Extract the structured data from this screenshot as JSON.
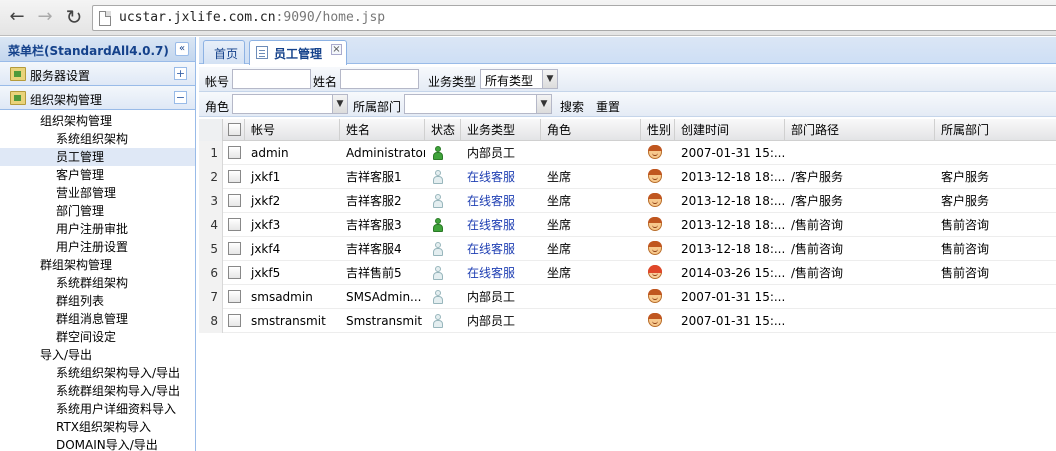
{
  "browser": {
    "url_host": "ucstar.jxlife.com.cn",
    "url_rest": ":9090/home.jsp"
  },
  "menu": {
    "title": "菜单栏(StandardAll4.0.7)",
    "sections": [
      {
        "label": "服务器设置",
        "toggle": "+"
      },
      {
        "label": "组织架构管理",
        "toggle": "−"
      }
    ],
    "tree": [
      {
        "label": "组织架构管理",
        "level": 1
      },
      {
        "label": "系统组织架构",
        "level": 2
      },
      {
        "label": "员工管理",
        "level": 2,
        "selected": true
      },
      {
        "label": "客户管理",
        "level": 2
      },
      {
        "label": "营业部管理",
        "level": 2
      },
      {
        "label": "部门管理",
        "level": 2
      },
      {
        "label": "用户注册审批",
        "level": 2
      },
      {
        "label": "用户注册设置",
        "level": 2
      },
      {
        "label": "群组架构管理",
        "level": 1
      },
      {
        "label": "系统群组架构",
        "level": 2
      },
      {
        "label": "群组列表",
        "level": 2
      },
      {
        "label": "群组消息管理",
        "level": 2
      },
      {
        "label": "群空间设定",
        "level": 2
      },
      {
        "label": "导入/导出",
        "level": 1
      },
      {
        "label": "系统组织架构导入/导出",
        "level": 2
      },
      {
        "label": "系统群组架构导入/导出",
        "level": 2
      },
      {
        "label": "系统用户详细资料导入",
        "level": 2
      },
      {
        "label": "RTX组织架构导入",
        "level": 2
      },
      {
        "label": "DOMAIN导入/导出",
        "level": 2
      }
    ]
  },
  "tabs": {
    "home": "首页",
    "active": "员工管理"
  },
  "filters": {
    "account_label": "帐号",
    "name_label": "姓名",
    "biz_type_label": "业务类型",
    "biz_type_value": "所有类型",
    "role_label": "角色",
    "dept_label": "所属部门",
    "search": "搜索",
    "reset": "重置"
  },
  "grid": {
    "columns": [
      "帐号",
      "姓名",
      "状态",
      "业务类型",
      "角色",
      "性别",
      "创建时间",
      "部门路径",
      "所属部门"
    ],
    "rows": [
      {
        "num": "1",
        "account": "admin",
        "name": "Administrator",
        "status": "online",
        "biz": "内部员工",
        "biz_link": false,
        "role": "",
        "gender": "male",
        "created": "2007-01-31 15:...",
        "path": "",
        "dept": ""
      },
      {
        "num": "2",
        "account": "jxkf1",
        "name": "吉祥客服1",
        "status": "offline",
        "biz": "在线客服",
        "biz_link": true,
        "role": "坐席",
        "gender": "male",
        "created": "2013-12-18 18:...",
        "path": "/客户服务",
        "dept": "客户服务"
      },
      {
        "num": "3",
        "account": "jxkf2",
        "name": "吉祥客服2",
        "status": "offline",
        "biz": "在线客服",
        "biz_link": true,
        "role": "坐席",
        "gender": "male",
        "created": "2013-12-18 18:...",
        "path": "/客户服务",
        "dept": "客户服务"
      },
      {
        "num": "4",
        "account": "jxkf3",
        "name": "吉祥客服3",
        "status": "online",
        "biz": "在线客服",
        "biz_link": true,
        "role": "坐席",
        "gender": "male",
        "created": "2013-12-18 18:...",
        "path": "/售前咨询",
        "dept": "售前咨询"
      },
      {
        "num": "5",
        "account": "jxkf4",
        "name": "吉祥客服4",
        "status": "offline",
        "biz": "在线客服",
        "biz_link": true,
        "role": "坐席",
        "gender": "male",
        "created": "2013-12-18 18:...",
        "path": "/售前咨询",
        "dept": "售前咨询"
      },
      {
        "num": "6",
        "account": "jxkf5",
        "name": "吉祥售前5",
        "status": "offline",
        "biz": "在线客服",
        "biz_link": true,
        "role": "坐席",
        "gender": "female",
        "created": "2014-03-26 15:...",
        "path": "/售前咨询",
        "dept": "售前咨询"
      },
      {
        "num": "7",
        "account": "smsadmin",
        "name": "SMSAdmin...",
        "status": "offline",
        "biz": "内部员工",
        "biz_link": false,
        "role": "",
        "gender": "male",
        "created": "2007-01-31 15:...",
        "path": "",
        "dept": ""
      },
      {
        "num": "8",
        "account": "smstransmit",
        "name": "Smstransmit",
        "status": "offline",
        "biz": "内部员工",
        "biz_link": false,
        "role": "",
        "gender": "male",
        "created": "2007-01-31 15:...",
        "path": "",
        "dept": ""
      }
    ]
  }
}
